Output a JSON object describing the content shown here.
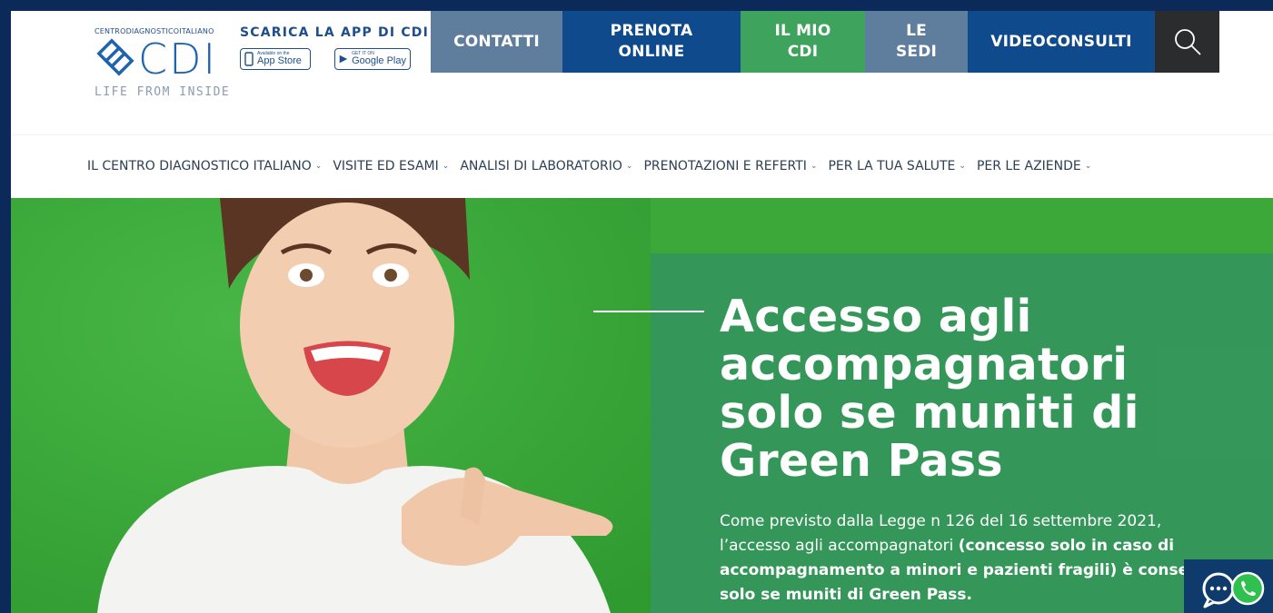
{
  "header": {
    "logo": {
      "top_text": "CENTRODIAGNOSTICOITALIANO",
      "brand": "CDI",
      "tagline": "LIFE FROM INSIDE"
    },
    "app": {
      "title": "SCARICA LA APP DI CDI",
      "appstore_small": "Available on the",
      "appstore_big": "App Store",
      "googleplay_small": "GET IT ON",
      "googleplay_big": "Google Play"
    },
    "top_nav": {
      "contatti": "CONTATTI",
      "prenota_line1": "PRENOTA",
      "prenota_line2": "ONLINE",
      "mio_line1": "IL MIO",
      "mio_line2": "CDI",
      "sedi_line1": "LE",
      "sedi_line2": "SEDI",
      "videoconsulti": "VIDEOCONSULTI",
      "search_icon": "search-icon"
    }
  },
  "main_nav": [
    {
      "label": "IL CENTRO DIAGNOSTICO ITALIANO"
    },
    {
      "label": "VISITE ED ESAMI"
    },
    {
      "label": "ANALISI DI LABORATORIO"
    },
    {
      "label": "PRENOTAZIONI E REFERTI"
    },
    {
      "label": "PER LA TUA SALUTE"
    },
    {
      "label": "PER LE AZIENDE"
    }
  ],
  "hero": {
    "title_line1": "Accesso agli",
    "title_line2": "accompagnatori",
    "title_line3": "solo se muniti di",
    "title_line4": "Green Pass",
    "text_line1": "Come previsto dalla Legge n 126 del 16 settembre 2021,",
    "text_line2_normal": "l’accesso agli accompagnatori ",
    "text_line2_bold": "(concesso solo in caso di",
    "text_line3": "accompagnamento a minori e pazienti fragili) è consent",
    "text_line4": "solo se muniti di Green Pass."
  },
  "chat": {
    "icon": "chat-icon",
    "whatsapp_icon": "whatsapp-icon"
  },
  "colors": {
    "frame": "#0b2a5a",
    "brand_blue": "#0f4a8c",
    "slate": "#5f7e9e",
    "green": "#3ea35c",
    "hero_bg": "#3ca83a",
    "panel": "#34965c"
  }
}
